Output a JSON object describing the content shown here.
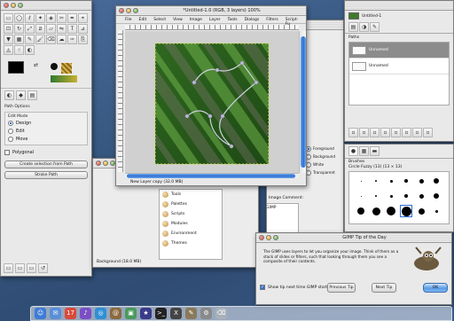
{
  "toolbox": {
    "tools": [
      "rect-select",
      "ellipse-select",
      "free-select",
      "fuzzy-select",
      "by-color-select",
      "scissors",
      "paths",
      "color-picker",
      "crop",
      "rotate",
      "scale",
      "shear",
      "perspective",
      "flip",
      "text",
      "measure",
      "bucket-fill",
      "blend",
      "pencil",
      "paintbrush",
      "eraser",
      "airbrush",
      "ink",
      "clone",
      "convolve",
      "smudge",
      "dodge-burn"
    ],
    "options_title": "Path Options",
    "mode_label": "Edit Mode",
    "modes": [
      "Design",
      "Edit",
      "Move"
    ],
    "polygonal_label": "Polygonal",
    "btn_create_selection": "Create selection from Path",
    "btn_stroke_path": "Stroke Path"
  },
  "image_window": {
    "title": "*Untitled-1.0 (RGB, 3 layers) 100%",
    "menus": [
      "File",
      "Edit",
      "Select",
      "View",
      "Image",
      "Layer",
      "Tools",
      "Dialogs",
      "Filters",
      "Script-Fu"
    ],
    "status": "New Layer copy (32.0 MB)",
    "colors": {
      "canvas_bg": "#3f7a2a",
      "stripe": "#6fb04a",
      "dark": "#254d19",
      "path": "#c9c9d9"
    }
  },
  "layers_dialog": {
    "title": "Untitled-1",
    "tab_label": "Paths",
    "rows": [
      "Unnamed",
      "Unnamed"
    ]
  },
  "brushes_dialog": {
    "title": "Brushes",
    "subtitle": "Circle Fuzzy (13) (13 × 13)",
    "rows": 5,
    "cols": 6
  },
  "background_dialog": {
    "modes": [
      "Foreground",
      "Background",
      "White",
      "Transparent"
    ],
    "items": [
      "Tools",
      "Palettes",
      "Scripts",
      "Modules",
      "Environment",
      "Themes"
    ],
    "fill_label": "Image Comment:",
    "comment": "Created with The GIMP",
    "status": "Background (18.0 MB)"
  },
  "tip_dialog": {
    "title": "GIMP Tip of the Day",
    "text": "The GIMP uses layers to let you organize your image. Think of them as a stack of slides or filters, such that looking through them you see a composite of their contents.",
    "checkbox_label": "Show tip next time GIMP starts",
    "previous_button": "Previous Tip",
    "next_button": "Next Tip",
    "ok_button": "OK"
  },
  "dock_icons": [
    {
      "name": "finder",
      "color": "#3d7bd6",
      "glyph": "☺"
    },
    {
      "name": "mail",
      "color": "#5a8fd8",
      "glyph": "✉"
    },
    {
      "name": "ical",
      "color": "#d84a3a",
      "glyph": "17"
    },
    {
      "name": "itunes",
      "color": "#7a4fc4",
      "glyph": "♪"
    },
    {
      "name": "safari",
      "color": "#2f8fd6",
      "glyph": "◎"
    },
    {
      "name": "addressbook",
      "color": "#8a6a3e",
      "glyph": "@"
    },
    {
      "name": "iphoto",
      "color": "#4a9a5a",
      "glyph": "▣"
    },
    {
      "name": "imovie",
      "color": "#3a3a8a",
      "glyph": "★"
    },
    {
      "name": "terminal",
      "color": "#222222",
      "glyph": ">_"
    },
    {
      "name": "x11",
      "color": "#444444",
      "glyph": "X"
    },
    {
      "name": "gimp",
      "color": "#8a7a5a",
      "glyph": "✎"
    },
    {
      "name": "prefs",
      "color": "#8a8a8a",
      "glyph": "⚙"
    },
    {
      "name": "trash",
      "color": "#a8b0ba",
      "glyph": "⌫"
    }
  ]
}
